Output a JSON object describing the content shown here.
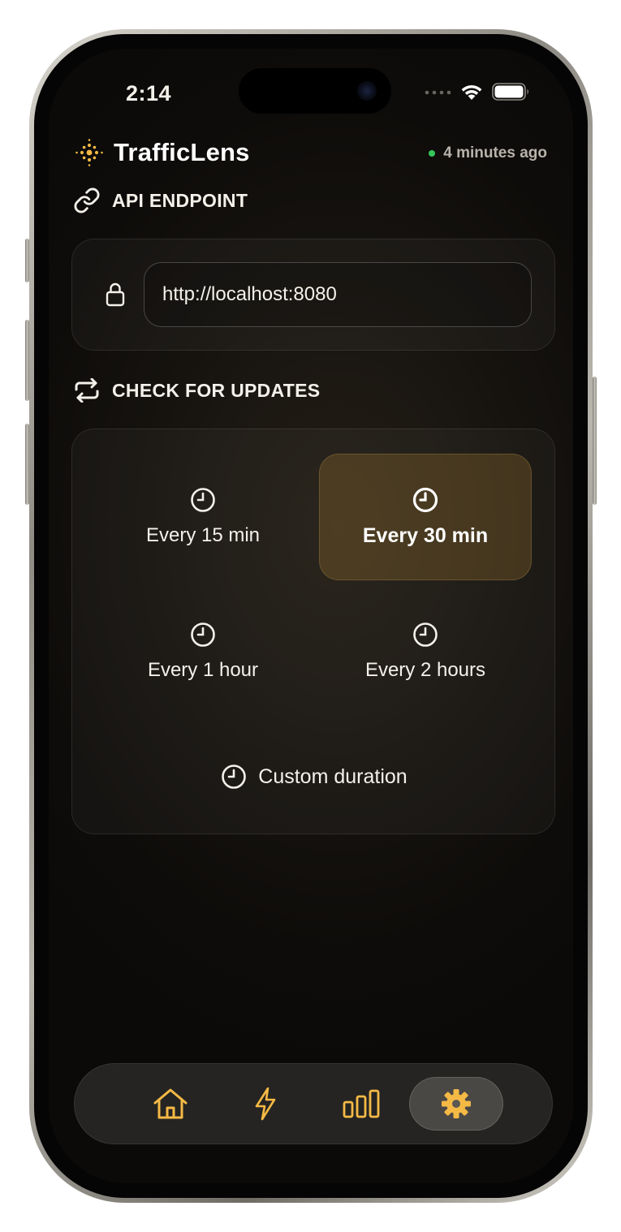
{
  "status_bar": {
    "time": "2:14"
  },
  "header": {
    "app_name": "TrafficLens",
    "last_updated": "4 minutes ago"
  },
  "endpoint": {
    "section_title": "API ENDPOINT",
    "url_value": "http://localhost:8080"
  },
  "updates": {
    "section_title": "CHECK FOR UPDATES",
    "options": [
      {
        "label": "Every 15 min",
        "selected": false
      },
      {
        "label": "Every 30 min",
        "selected": true
      },
      {
        "label": "Every 1 hour",
        "selected": false
      },
      {
        "label": "Every 2 hours",
        "selected": false
      }
    ],
    "custom_label": "Custom duration"
  },
  "tabbar": {
    "items": [
      {
        "icon": "home-icon"
      },
      {
        "icon": "bolt-icon"
      },
      {
        "icon": "bar-chart-icon"
      },
      {
        "icon": "gear-icon",
        "active": true
      }
    ]
  },
  "colors": {
    "accent": "#f5b945",
    "status_green": "#34c759",
    "selected_bg": "#3a2e1c"
  }
}
